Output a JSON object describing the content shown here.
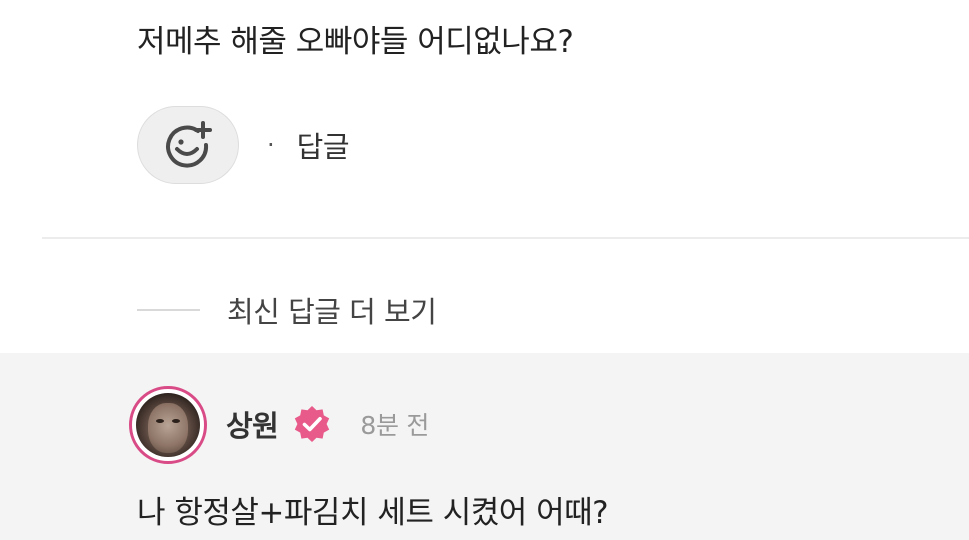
{
  "comment": {
    "text": "저메추 해줄 오빠야들 어디없나요?",
    "reaction_icon": "add-emoji-icon",
    "separator": "·",
    "reply_label": "답글"
  },
  "more_replies": {
    "label": "최신 답글 더 보기"
  },
  "reply": {
    "author": "상원",
    "verified_icon": "verified-badge-icon",
    "time": "8분 전",
    "text": "나 항정살+파김치 세트 시켰어 어때?"
  },
  "colors": {
    "accent": "#d94b86",
    "reply_background": "#f4f4f4",
    "muted_text": "#9a9a9a",
    "button_background": "#efefef"
  }
}
